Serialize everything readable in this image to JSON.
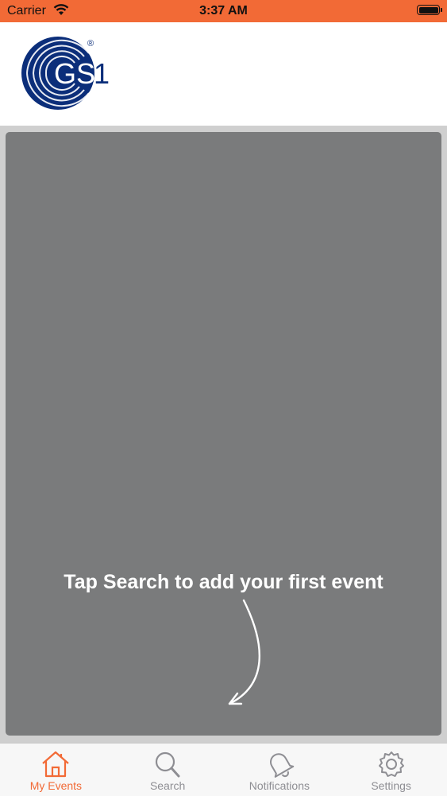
{
  "status_bar": {
    "carrier": "Carrier",
    "time": "3:37 AM"
  },
  "header": {
    "logo_text": "GS1",
    "logo_mark": "®"
  },
  "main": {
    "empty_hint": "Tap Search to add your first event"
  },
  "tab_bar": {
    "tabs": [
      {
        "label": "My Events",
        "icon": "home-icon",
        "active": true
      },
      {
        "label": "Search",
        "icon": "search-icon",
        "active": false
      },
      {
        "label": "Notifications",
        "icon": "bell-icon",
        "active": false
      },
      {
        "label": "Settings",
        "icon": "gear-icon",
        "active": false
      }
    ]
  },
  "colors": {
    "accent": "#f26a36",
    "brand_blue": "#0b2e7a",
    "overlay": "#7a7b7c",
    "tab_inactive": "#8e8e93"
  }
}
